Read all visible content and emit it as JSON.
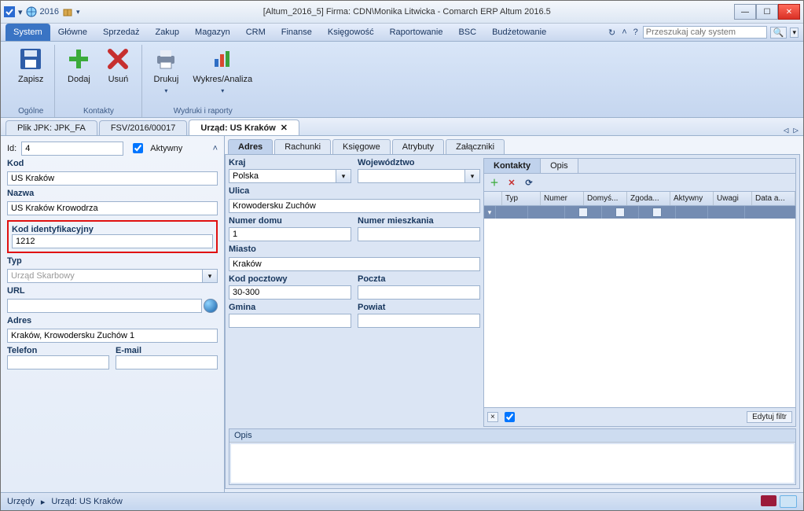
{
  "window": {
    "year": "2016",
    "title": "[Altum_2016_5] Firma: CDN\\Monika Litwicka - Comarch ERP Altum 2016.5"
  },
  "menu": {
    "tabs": [
      "System",
      "Główne",
      "Sprzedaż",
      "Zakup",
      "Magazyn",
      "CRM",
      "Finanse",
      "Księgowość",
      "Raportowanie",
      "BSC",
      "Budżetowanie"
    ],
    "search_placeholder": "Przeszukaj cały system"
  },
  "ribbon": {
    "groups": [
      {
        "label": "Ogólne",
        "items": [
          {
            "name": "save",
            "label": "Zapisz"
          }
        ]
      },
      {
        "label": "Kontakty",
        "items": [
          {
            "name": "add",
            "label": "Dodaj"
          },
          {
            "name": "delete",
            "label": "Usuń"
          }
        ]
      },
      {
        "label": "Wydruki i raporty",
        "items": [
          {
            "name": "print",
            "label": "Drukuj"
          },
          {
            "name": "chart",
            "label": "Wykres/Analiza"
          }
        ]
      }
    ]
  },
  "doc_tabs": [
    {
      "label": "Plik JPK: JPK_FA",
      "active": false
    },
    {
      "label": "FSV/2016/00017",
      "active": false
    },
    {
      "label": "Urząd: US Kraków",
      "active": true
    }
  ],
  "left": {
    "id_label": "Id:",
    "id_value": "4",
    "active_label": "Aktywny",
    "kod_label": "Kod",
    "kod_value": "US Kraków",
    "nazwa_label": "Nazwa",
    "nazwa_value": "US Kraków Krowodrza",
    "kodid_label": "Kod identyfikacyjny",
    "kodid_value": "1212",
    "typ_label": "Typ",
    "typ_value": "Urząd Skarbowy",
    "url_label": "URL",
    "url_value": "",
    "adres_label": "Adres",
    "adres_value": "Kraków, Krowodersku Zuchów 1",
    "telefon_label": "Telefon",
    "telefon_value": "",
    "email_label": "E-mail",
    "email_value": ""
  },
  "inner_tabs": [
    "Adres",
    "Rachunki",
    "Księgowe",
    "Atrybuty",
    "Załączniki"
  ],
  "adres": {
    "kraj_label": "Kraj",
    "kraj_value": "Polska",
    "woj_label": "Województwo",
    "woj_value": "",
    "ulica_label": "Ulica",
    "ulica_value": "Krowodersku Zuchów",
    "nrdomu_label": "Numer domu",
    "nrdomu_value": "1",
    "nrmieszk_label": "Numer mieszkania",
    "nrmieszk_value": "",
    "miasto_label": "Miasto",
    "miasto_value": "Kraków",
    "kodp_label": "Kod pocztowy",
    "kodp_value": "30-300",
    "poczta_label": "Poczta",
    "poczta_value": "",
    "gmina_label": "Gmina",
    "gmina_value": "",
    "powiat_label": "Powiat",
    "powiat_value": ""
  },
  "contacts": {
    "tabs": [
      "Kontakty",
      "Opis"
    ],
    "columns": [
      "",
      "Typ",
      "Numer",
      "Domyś...",
      "Zgoda...",
      "Aktywny",
      "Uwagi",
      "Data a..."
    ],
    "edit_filter": "Edytuj filtr"
  },
  "opis_label": "Opis",
  "breadcrumb": {
    "root": "Urzędy",
    "sep": "▸",
    "current": "Urząd: US Kraków"
  },
  "colors": {
    "accent": "#3a74c4",
    "red": "#e01010",
    "status1": "#9b1a3a",
    "status2": "#6bb2e6"
  }
}
